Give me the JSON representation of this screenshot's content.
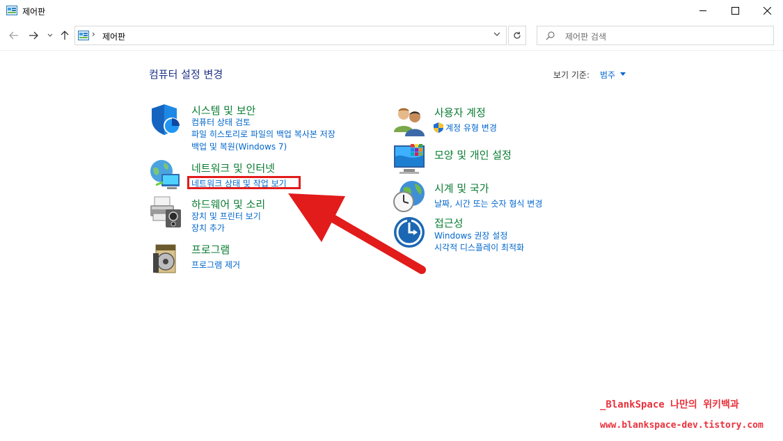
{
  "window": {
    "title": "제어판",
    "minimize_icon": "minimize-icon",
    "maximize_icon": "maximize-icon",
    "close_icon": "close-icon"
  },
  "address": {
    "separator": "›",
    "path": "제어판",
    "search_placeholder": "제어판 검색"
  },
  "main": {
    "heading": "컴퓨터 설정 변경",
    "view_by_label": "보기 기준:",
    "view_by_value": "범주"
  },
  "categories_left": [
    {
      "title": "시스템 및 보안",
      "icon": "shield-icon",
      "links": [
        "컴퓨터 상태 검토",
        "파일 히스토리로 파일의 백업 복사본 저장",
        "백업 및 복원(Windows 7)"
      ]
    },
    {
      "title": "네트워크 및 인터넷",
      "icon": "network-globe-icon",
      "links": [
        "네트워크 상태 및 작업 보기"
      ]
    },
    {
      "title": "하드웨어 및 소리",
      "icon": "printer-icon",
      "links": [
        "장치 및 프린터 보기",
        "장치 추가"
      ]
    },
    {
      "title": "프로그램",
      "icon": "programs-disc-icon",
      "links": [
        "프로그램 제거"
      ]
    }
  ],
  "categories_right": [
    {
      "title": "사용자 계정",
      "icon": "users-icon",
      "links": [
        "계정 유형 변경"
      ]
    },
    {
      "title": "모양 및 개인 설정",
      "icon": "monitor-personalize-icon",
      "links": []
    },
    {
      "title": "시계 및 국가",
      "icon": "clock-globe-icon",
      "links": [
        "날짜, 시간 또는 숫자 형식 변경"
      ]
    },
    {
      "title": "접근성",
      "icon": "ease-of-access-icon",
      "links": [
        "Windows 권장 설정",
        "시각적 디스플레이 최적화"
      ]
    }
  ],
  "annotation": {
    "highlight_color": "#e21b1b",
    "arrow_color": "#e21b1b"
  },
  "watermark": {
    "line1": "_BlankSpace 나만의 위키백과",
    "line2": "www.blankspace-dev.tistory.com"
  }
}
